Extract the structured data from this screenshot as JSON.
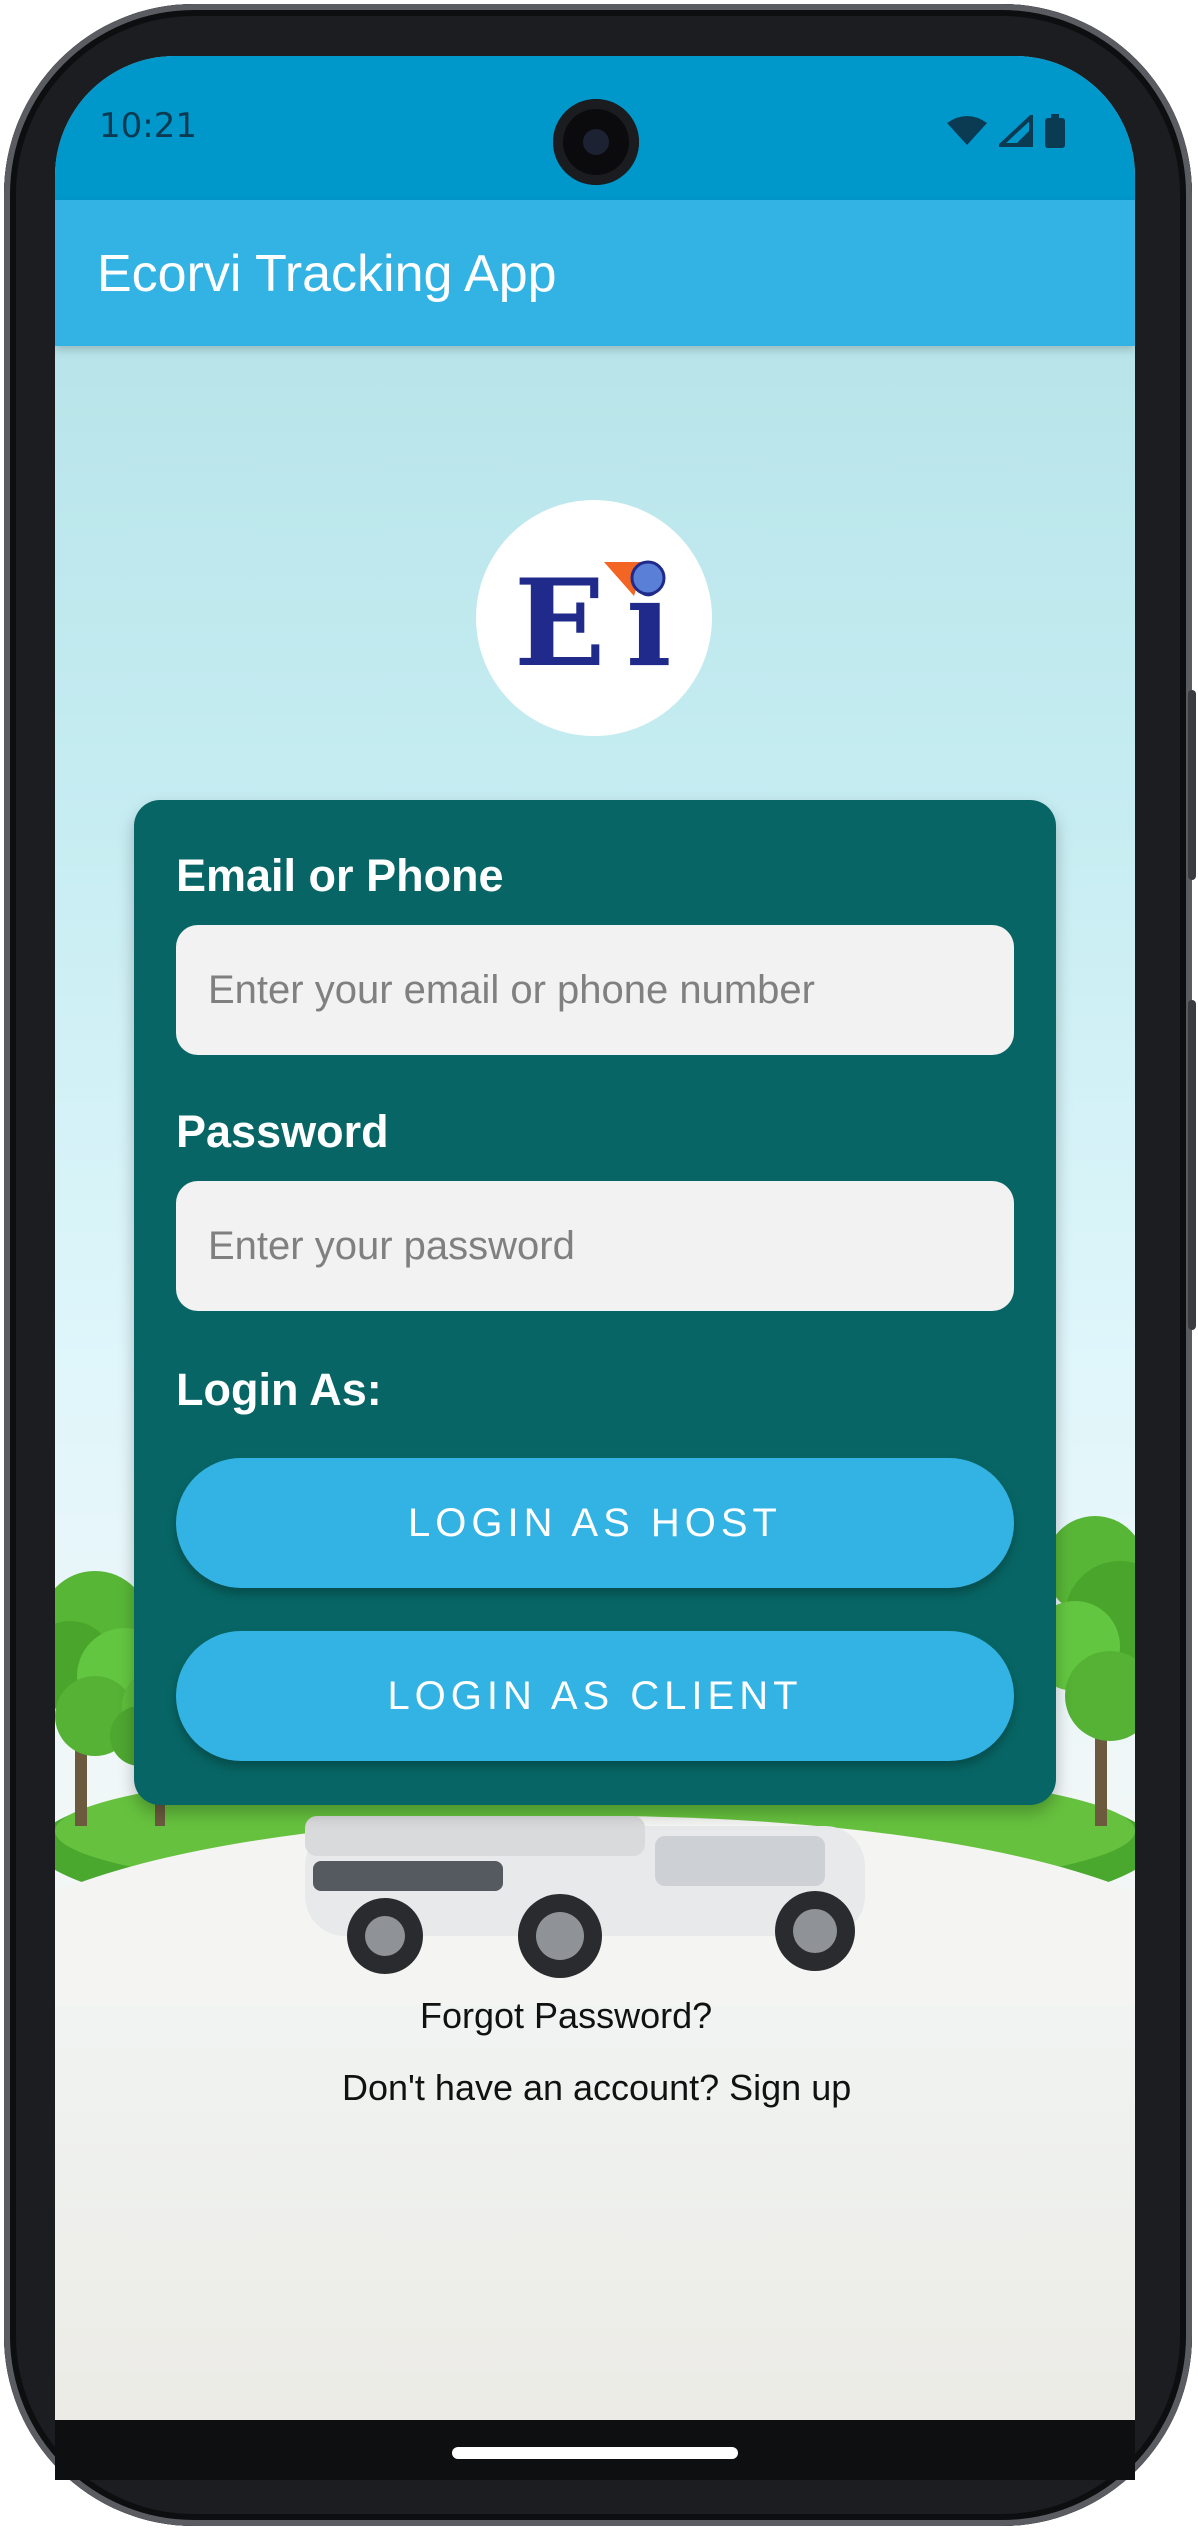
{
  "status_bar": {
    "time": "10:21",
    "icons": [
      "wifi-icon",
      "signal-icon",
      "battery-icon"
    ]
  },
  "app_bar": {
    "title": "Ecorvi Tracking App"
  },
  "logo": {
    "text": "Ei",
    "colors": {
      "letters": "#1f2a8a",
      "accent": "#f26522",
      "dot": "#5a7fd6"
    }
  },
  "login_form": {
    "email_label": "Email or Phone",
    "email_placeholder": "Enter your email or phone number",
    "password_label": "Password",
    "password_placeholder": "Enter your password",
    "login_as_label": "Login As:",
    "host_button": "LOGIN AS HOST",
    "client_button": "LOGIN AS CLIENT"
  },
  "links": {
    "forgot_password": "Forgot Password?",
    "signup": "Don't have an account? Sign up"
  },
  "colors": {
    "status_bar": "#0097cb",
    "app_bar": "#33b3e3",
    "card": "#076665",
    "button": "#33b3e3"
  }
}
